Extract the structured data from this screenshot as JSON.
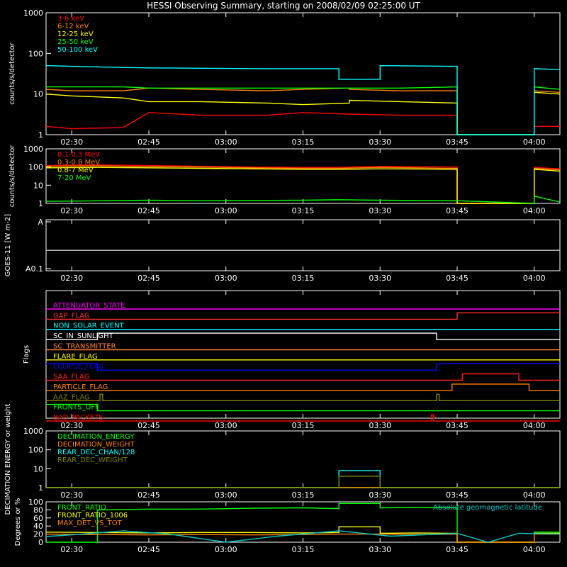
{
  "title": "HESSI Observing Summary, starting on 2008/02/09 02:25:00 UT",
  "time_ticks": [
    "02:30",
    "02:45",
    "03:00",
    "03:15",
    "03:30",
    "03:45",
    "04:00"
  ],
  "time_tick_minutes": [
    5,
    20,
    35,
    50,
    65,
    80,
    95
  ],
  "time_range_minutes": [
    0,
    100
  ],
  "chart_data": [
    {
      "type": "line",
      "panel": "count-rates-low",
      "ylabel": "counts/s/detector",
      "yscale": "log",
      "ylim": [
        1,
        1000
      ],
      "yticks": [
        "1",
        "10",
        "100",
        "1000"
      ],
      "legend_placement": "top-left",
      "series": [
        {
          "name": "3-6 keV",
          "color": "#ff0000",
          "x": [
            0,
            5,
            15,
            20,
            30,
            43,
            43,
            50,
            59,
            69,
            80,
            80,
            95,
            95,
            100
          ],
          "y": [
            1.6,
            1.4,
            1.5,
            3.5,
            3,
            3,
            3,
            3.5,
            3.2,
            3,
            3,
            1,
            1,
            1.6,
            1.6
          ]
        },
        {
          "name": "6-12 keV",
          "color": "#ff8000",
          "x": [
            0,
            5,
            15,
            20,
            30,
            43,
            50,
            59,
            59,
            69,
            80,
            80,
            95,
            95,
            100
          ],
          "y": [
            13,
            12,
            12,
            14,
            13,
            12,
            13,
            14,
            13,
            12,
            12,
            1,
            1,
            12,
            11
          ]
        },
        {
          "name": "12-25 keV",
          "color": "#ffff00",
          "x": [
            0,
            5,
            15,
            20,
            30,
            43,
            50,
            59,
            59,
            69,
            80,
            80,
            95,
            95,
            100
          ],
          "y": [
            10,
            9,
            8,
            6.5,
            6.5,
            6,
            5.5,
            6,
            7,
            6.5,
            6,
            1,
            1,
            11,
            10
          ]
        },
        {
          "name": "25-50 keV",
          "color": "#00ff00",
          "x": [
            0,
            5,
            15,
            20,
            30,
            43,
            50,
            59,
            69,
            80,
            80,
            95,
            95,
            100
          ],
          "y": [
            15,
            15,
            15,
            14,
            14,
            14,
            14,
            14,
            14,
            15,
            1,
            1,
            15,
            13
          ]
        },
        {
          "name": "50-100 keV",
          "color": "#00ffff",
          "x": [
            0,
            5,
            15,
            20,
            30,
            43,
            50,
            57,
            57,
            65,
            65,
            80,
            80,
            95,
            95,
            100
          ],
          "y": [
            50,
            48,
            45,
            44,
            43,
            42,
            42,
            42,
            23,
            23,
            50,
            48,
            1,
            1,
            42,
            40
          ]
        }
      ]
    },
    {
      "type": "line",
      "panel": "count-rates-high",
      "ylabel": "counts/s/detector",
      "yscale": "log",
      "ylim": [
        1,
        1000
      ],
      "yticks": [
        "1",
        "10",
        "100",
        "1000"
      ],
      "legend_placement": "top-left",
      "series": [
        {
          "name": "0.1-0.3 MeV",
          "color": "#ff0000",
          "x": [
            0,
            10,
            20,
            30,
            40,
            50,
            57,
            65,
            72,
            80,
            80,
            95,
            95,
            100
          ],
          "y": [
            120,
            130,
            120,
            110,
            100,
            95,
            95,
            110,
            105,
            100,
            1,
            1,
            95,
            80
          ]
        },
        {
          "name": "0.3-0.8 MeV",
          "color": "#ff8000",
          "x": [
            0,
            10,
            20,
            30,
            40,
            50,
            57,
            65,
            72,
            80,
            80,
            95,
            95,
            100
          ],
          "y": [
            110,
            115,
            105,
            100,
            90,
            85,
            85,
            95,
            90,
            85,
            1,
            1,
            85,
            70
          ]
        },
        {
          "name": "0.8-7 MeV",
          "color": "#ffff00",
          "x": [
            0,
            10,
            20,
            30,
            40,
            50,
            57,
            65,
            72,
            80,
            80,
            95,
            95,
            100
          ],
          "y": [
            90,
            95,
            90,
            85,
            80,
            75,
            75,
            80,
            78,
            75,
            1,
            1,
            75,
            60
          ]
        },
        {
          "name": "7-20 MeV",
          "color": "#00ff00",
          "x": [
            0,
            20,
            30,
            50,
            57,
            65,
            80,
            95,
            95,
            100
          ],
          "y": [
            1.3,
            1.5,
            1.4,
            1.5,
            1.6,
            1.5,
            1.4,
            1,
            2.5,
            1.2
          ]
        }
      ]
    },
    {
      "type": "line",
      "panel": "goes",
      "ylabel": "GOES-11 [W m-2]",
      "yticks": [
        "A",
        "A0.1"
      ],
      "series": [
        {
          "name": "",
          "color": "#c8c8c8",
          "x": [
            0,
            100
          ],
          "y": [
            0.4,
            0.4
          ]
        }
      ]
    },
    {
      "type": "line",
      "panel": "flags",
      "ylabel": "Flags",
      "flags": [
        {
          "label": "ATTENUATOR_STATE",
          "color": "#ff00ff",
          "x": [
            0,
            100
          ],
          "y": [
            0,
            0
          ]
        },
        {
          "label": "GAP_FLAG",
          "color": "#ff3030",
          "x": [
            0,
            80,
            80,
            100
          ],
          "y": [
            0,
            0,
            1,
            1
          ]
        },
        {
          "label": "NON_SOLAR_EVENT",
          "color": "#00ffff",
          "x": [
            0,
            100
          ],
          "y": [
            0,
            0
          ]
        },
        {
          "label": "SC_IN_SUNLIGHT",
          "color": "#ffffff",
          "x": [
            0,
            10,
            10,
            76,
            76,
            100
          ],
          "y": [
            0,
            0,
            1,
            1,
            0,
            0
          ]
        },
        {
          "label": "SC_TRANSMITTER",
          "color": "#ff8040",
          "x": [
            0,
            100
          ],
          "y": [
            0,
            0
          ]
        },
        {
          "label": "FLARE_FLAG",
          "color": "#ffff00",
          "x": [
            0,
            100
          ],
          "y": [
            0,
            0
          ]
        },
        {
          "label": "ECLIPSE_FLAG",
          "color": "#0000ff",
          "x": [
            0,
            10,
            10,
            76,
            76,
            100
          ],
          "y": [
            1,
            1,
            0,
            0,
            1,
            1
          ]
        },
        {
          "label": "SAA_FLAG",
          "color": "#ff2020",
          "x": [
            0,
            81,
            81,
            92,
            92,
            100
          ],
          "y": [
            0,
            0,
            1,
            1,
            0,
            0
          ]
        },
        {
          "label": "PARTICLE_FLAG",
          "color": "#ff8000",
          "x": [
            0,
            79,
            79,
            94,
            94,
            100
          ],
          "y": [
            0,
            0,
            1,
            1,
            0,
            0
          ]
        },
        {
          "label": "AAZ_FLAG",
          "color": "#808000",
          "x": [
            0,
            10.5,
            10.5,
            11,
            11,
            76,
            76,
            76.5,
            76.5,
            100
          ],
          "y": [
            0,
            0,
            1,
            1,
            0,
            0,
            1,
            1,
            0,
            0
          ]
        },
        {
          "label": "FRONTS_OFF",
          "color": "#00ff00",
          "x": [
            0,
            10,
            10,
            100
          ],
          "y": [
            1,
            1,
            0,
            0
          ]
        },
        {
          "label": "BAD_PACKETS",
          "color": "#ff0000",
          "x": [
            0,
            75,
            75,
            75.4,
            75.4,
            100
          ],
          "y": [
            0,
            0,
            1,
            1,
            0,
            0
          ]
        }
      ]
    },
    {
      "type": "line",
      "panel": "decimation",
      "ylabel": "DECIMATION ENERGY or weight",
      "yscale": "log",
      "ylim": [
        1,
        1000
      ],
      "yticks": [
        "1",
        "10",
        "100",
        "1000"
      ],
      "legend_placement": "top-left",
      "series": [
        {
          "name": "DECIMATION_ENERGY",
          "color": "#00ff00",
          "x": [
            0,
            100
          ],
          "y": [
            1,
            1
          ]
        },
        {
          "name": "DECIMATION_WEIGHT",
          "color": "#ff8000",
          "x": [
            0,
            100
          ],
          "y": [
            1,
            1
          ]
        },
        {
          "name": "REAR_DEC_CHAN/128",
          "color": "#00ffff",
          "x": [
            0,
            57,
            57,
            65,
            65,
            100
          ],
          "y": [
            1,
            1,
            8,
            8,
            1,
            1
          ]
        },
        {
          "name": "REAR_DEC_WEIGHT",
          "color": "#808000",
          "x": [
            0,
            57,
            57,
            65,
            65,
            100
          ],
          "y": [
            1,
            1,
            4,
            4,
            1,
            1
          ]
        }
      ]
    },
    {
      "type": "line",
      "panel": "ratios",
      "ylabel": "Degrees or %",
      "ylim": [
        0,
        100
      ],
      "yticks": [
        "0",
        "20",
        "40",
        "60",
        "80",
        "100"
      ],
      "legend_placement": "top-left",
      "annotation": "Absolute geomagnetic latitude",
      "series": [
        {
          "name": "FRONT_RATIO",
          "color": "#00ff00",
          "x": [
            0,
            10,
            10,
            20,
            30,
            40,
            50,
            57,
            57,
            65,
            65,
            72,
            80,
            80,
            95,
            95,
            100
          ],
          "y": [
            0,
            0,
            80,
            82,
            82,
            84,
            85,
            83,
            96,
            96,
            85,
            86,
            85,
            0,
            0,
            25,
            25
          ]
        },
        {
          "name": "FRONT_RATIO_1006",
          "color": "#ffff00",
          "x": [
            0,
            10,
            20,
            30,
            40,
            50,
            57,
            57,
            65,
            65,
            72,
            80,
            80,
            95,
            95,
            100
          ],
          "y": [
            25,
            24,
            23,
            24,
            24,
            23,
            24,
            38,
            38,
            22,
            23,
            22,
            0,
            0,
            22,
            22
          ]
        },
        {
          "name": "MAX_DET_VS_TOT",
          "color": "#ff8000",
          "x": [
            0,
            10,
            20,
            30,
            40,
            50,
            57,
            65,
            72,
            80,
            80,
            95,
            95,
            100
          ],
          "y": [
            20,
            19,
            18,
            19,
            18,
            19,
            20,
            20,
            19,
            20,
            0,
            0,
            20,
            20
          ]
        },
        {
          "name": "",
          "color": "#00c8c8",
          "x": [
            0,
            7,
            15,
            24,
            35,
            45,
            57,
            67,
            80,
            86,
            92,
            100
          ],
          "y": [
            14,
            20,
            28,
            20,
            0,
            15,
            28,
            15,
            22,
            0,
            22,
            20
          ]
        }
      ]
    }
  ]
}
